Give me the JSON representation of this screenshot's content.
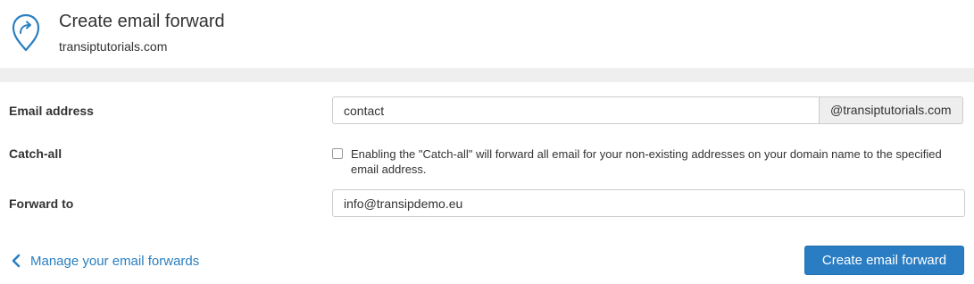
{
  "header": {
    "title": "Create email forward",
    "subtitle": "transiptutorials.com",
    "icon": "email-forward-pin-icon",
    "icon_color": "#2a7fc1"
  },
  "form": {
    "email_address": {
      "label": "Email address",
      "value": "contact",
      "domain_suffix": "@transiptutorials.com"
    },
    "catch_all": {
      "label": "Catch-all",
      "checked": false,
      "description": "Enabling the \"Catch-all\" will forward all email for your non-existing addresses on your domain name to the specified email address."
    },
    "forward_to": {
      "label": "Forward to",
      "value": "info@transipdemo.eu"
    }
  },
  "footer": {
    "back_link_label": "Manage your email forwards",
    "back_icon": "chevron-left-icon",
    "submit_label": "Create email forward"
  },
  "colors": {
    "accent": "#2a7fc1",
    "button": "#2a7dc3",
    "band": "#efefef"
  }
}
